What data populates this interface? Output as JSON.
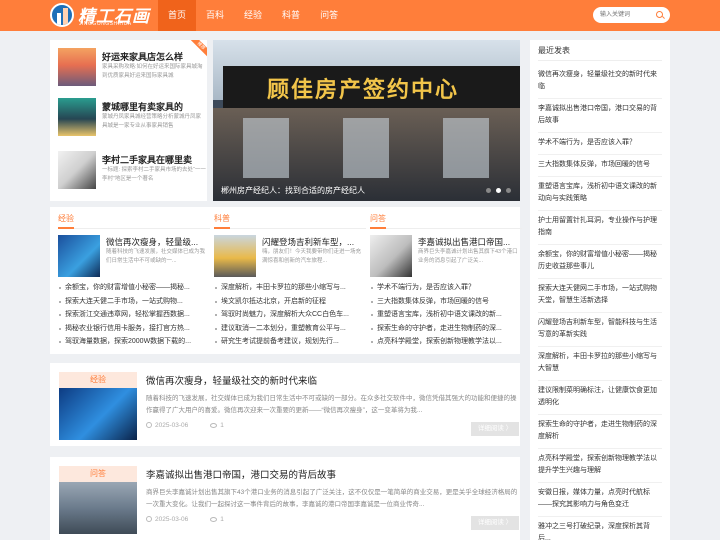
{
  "header": {
    "logo_name": "精工石画",
    "logo_sub": "JINGGONGSHIHUA",
    "nav": [
      "首页",
      "百科",
      "经验",
      "科普",
      "问答"
    ],
    "search_placeholder": "输入关键词"
  },
  "top_list": {
    "corner_tag": "推荐",
    "items": [
      {
        "title": "好运来家具店怎么样",
        "desc": "家具采购攻略:如何在好运来国际家具城淘到优质家具好运来国际家具城"
      },
      {
        "title": "蒙城哪里有卖家具的",
        "desc": "蒙城丹凤家具城经营策略分析蒙城丹凤家具城是一家专业从事家具销售"
      },
      {
        "title": "李村二手家具在哪里卖",
        "desc": "一标题: 探索李村二手家具市场的去处“一一李村”地区是一个著名"
      }
    ]
  },
  "slider": {
    "sign_text": "顾佳房产签约中心",
    "caption": "郴州房产经纪人：找到合适的房产经纪人"
  },
  "categories": [
    {
      "label": "经验",
      "feature_title": "微信再次瘦身，轻量级...",
      "feature_desc": "随着科技的飞速发展，社交媒体已成为我们日常生活中不可或缺的一...",
      "items": [
        "余额宝，你的财富增值小秘密——揭秘...",
        "探索大连天健二手市场，一站式购物...",
        "探索浙江交通违章网，轻松掌握西数据...",
        "揭秘农业银行信用卡服务，接打官方热...",
        "驾驭海量数据，探索2000W数据下载的..."
      ]
    },
    {
      "label": "科普",
      "feature_title": "闪耀登场吉利新车型，...",
      "feature_desc": "嗨，朋友们！今天我要带你们走进一场充满惊喜和创新的汽车旅程...",
      "items": [
        "深度解析，丰田卡罗拉的那些小缩写与...",
        "埃文凯尔抵达北京，开启新的征程",
        "驾驭时尚魅力，深度解析大众CC白色车...",
        "建议取消一二本划分，重塑教育公平与...",
        "研究生考试提前备考建议，规划先行..."
      ]
    },
    {
      "label": "问答",
      "feature_title": "李嘉诚拟出售港口帝国...",
      "feature_desc": "商界巨头李嘉诚计划出售其旗下43个港口业务的消息引起了广泛关...",
      "items": [
        "学术不端行为，是否应该入罪？",
        "三大指数集体反弹，市场回暖的信号",
        "重塑语言宝库，浅析初中语文课改的新...",
        "探索生命的守护者，走进生物制药的深...",
        "点亮科学殿堂，探索创新物理教学法以..."
      ]
    }
  ],
  "articles": [
    {
      "badge": "经验",
      "title": "微信再次瘦身，轻量级社交的新时代来临",
      "desc": "随着科技的飞速发展，社交媒体已成为我们日常生活中不可或缺的一部分。在众多社交软件中，微信凭借其强大的功能和便捷的操作赢得了广大用户的喜爱。微信再次迎来一次重要的更新——“微信再次瘦身”，这一变革将为我...",
      "date": "2025-03-06",
      "views": "1",
      "more": "详细阅读 〉"
    },
    {
      "badge": "问答",
      "title": "李嘉诚拟出售港口帝国，港口交易的背后故事",
      "desc": "商界巨头李嘉诚计划出售其旗下43个港口业务的消息引起了广泛关注，这不仅仅是一笔简单的商业交易，更是关乎全球经济格局的一次重大变化。让我们一起探讨这一事件背后的故事，李嘉诚的港口帝国李嘉诚是一位商业传奇...",
      "date": "2025-03-06",
      "views": "1",
      "more": "详细阅读 〉"
    }
  ],
  "sidebar": {
    "title": "最近发表",
    "items": [
      "微信再次瘦身，轻量级社交的新时代来临",
      "李嘉诚拟出售港口帝国，港口交易的背后故事",
      "学术不端行为，是否应该入罪？",
      "三大指数集体反弹，市场回暖的信号",
      "重塑语言宝库，浅析初中语文课改的新动向与实践策略",
      "护士用留置针扎耳洞，专业操作与护理指南",
      "余额宝，你的财富增值小秘密——揭秘历史收益那些事儿",
      "探索大连天健网二手市场，一站式购物天堂，智慧生活新选择",
      "闪耀登场吉利新车型，智能科技与生活写意的革新实践",
      "深度解析，丰田卡罗拉的那些小缩写与大智慧",
      "建议限制菜明确标注，让健康饮食更加透明化",
      "探索生命的守护者，走进生物制药的深度解析",
      "点亮科学殿堂，探索创新物理教学法以提升学生兴趣与理解",
      "安徽日报，媒体力量，点亮时代航标——探究其影响力与角色变迁",
      "雅冲之三号打破纪录，深度探析其背后..."
    ]
  }
}
